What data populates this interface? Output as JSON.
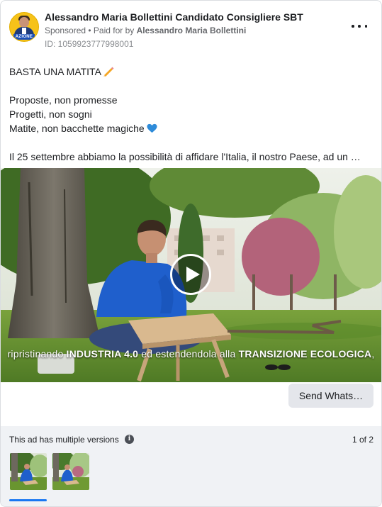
{
  "header": {
    "page_name": "Alessandro Maria Bollettini Candidato Consigliere SBT",
    "sponsored": "Sponsored",
    "paid_for_prefix": " • Paid for by ",
    "paid_for_by": "Alessandro Maria Bollettini",
    "ad_id": "ID: 1059923777998001",
    "avatar_badge": "AZIONE"
  },
  "post": {
    "line1": "BASTA UNA MATITA",
    "line2": "Proposte, non promesse",
    "line3": "Progetti, non sogni",
    "line4": "Matite, non bacchette magiche",
    "line5": "Il 25 settembre abbiamo la possibilità di affidare l'Italia, il nostro Paese, ad un …",
    "icons": [
      "pencil-icon",
      "blue-heart-icon"
    ]
  },
  "video": {
    "subtitle_a": "ripristinando ",
    "subtitle_b": "INDUSTRIA 4.0",
    "subtitle_c": " ed estendendola alla ",
    "subtitle_d": "TRANSIZIONE ECOLOGICA",
    "subtitle_e": ","
  },
  "cta": {
    "label": "Send Whats…"
  },
  "versions": {
    "label": "This ad has multiple versions",
    "count": "1 of 2",
    "selected_index": 1
  },
  "colors": {
    "accent": "#1877f2",
    "footer_bg": "#f0f2f5",
    "button_bg": "#e4e6eb",
    "avatar_bg": "#f6c21a"
  }
}
